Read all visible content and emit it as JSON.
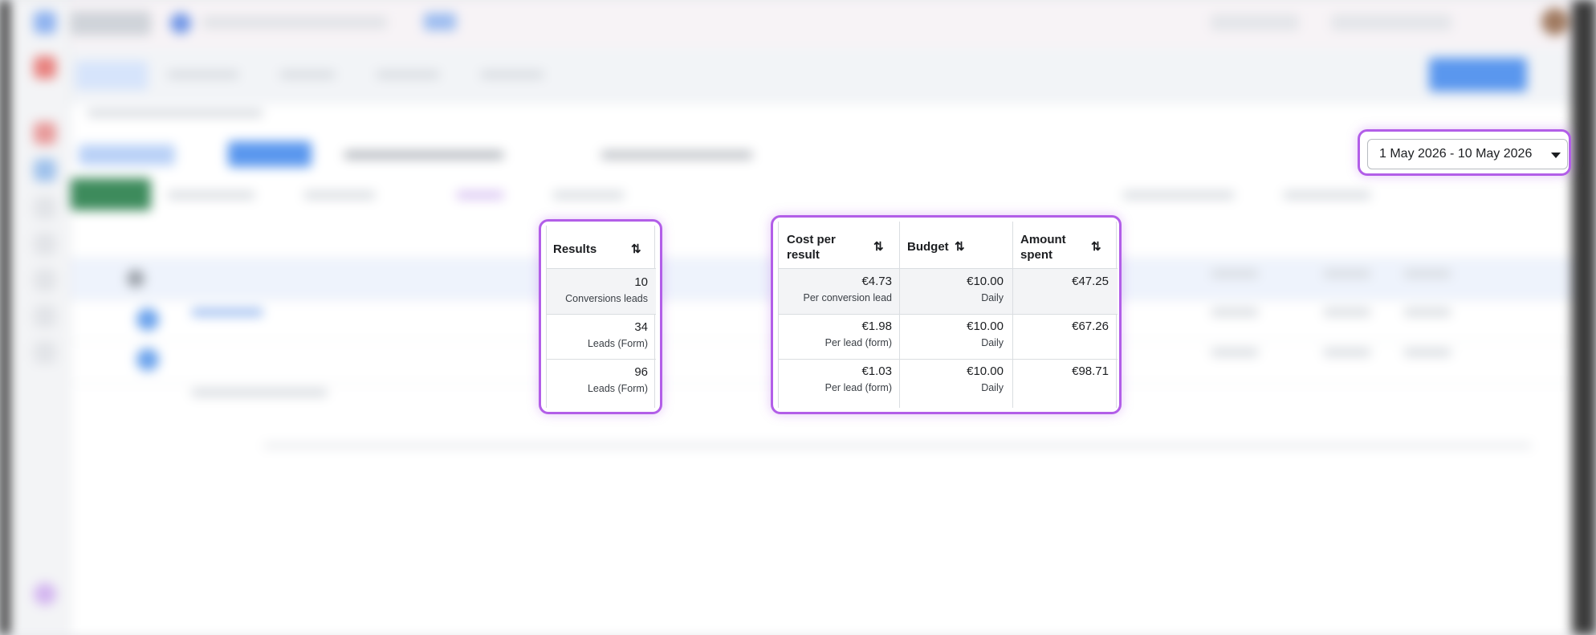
{
  "date_range": {
    "label": "1 May 2026 - 10 May 2026",
    "caret_icon": "caret-down-icon"
  },
  "results_column": {
    "header": "Results",
    "sort_icon": "sort-arrows-icon",
    "rows": [
      {
        "value": "10",
        "sub": "Conversions leads"
      },
      {
        "value": "34",
        "sub": "Leads (Form)"
      },
      {
        "value": "96",
        "sub": "Leads (Form)"
      }
    ]
  },
  "metrics_table": {
    "headers": {
      "cost_per_result_line1": "Cost per",
      "cost_per_result_line2": "result",
      "budget": "Budget",
      "amount_spent_line1": "Amount",
      "amount_spent_line2": "spent"
    },
    "sort_icon": "sort-arrows-icon",
    "rows": [
      {
        "cost": "€4.73",
        "cost_sub": "Per conversion lead",
        "budget": "€10.00",
        "budget_sub": "Daily",
        "spent": "€47.25"
      },
      {
        "cost": "€1.98",
        "cost_sub": "Per lead (form)",
        "budget": "€10.00",
        "budget_sub": "Daily",
        "spent": "€67.26"
      },
      {
        "cost": "€1.03",
        "cost_sub": "Per lead (form)",
        "budget": "€10.00",
        "budget_sub": "Daily",
        "spent": "€98.71"
      }
    ]
  },
  "colors": {
    "highlight": "#b25ee8",
    "primary_blue": "#1877f2",
    "create_green": "#2e7d4f"
  }
}
